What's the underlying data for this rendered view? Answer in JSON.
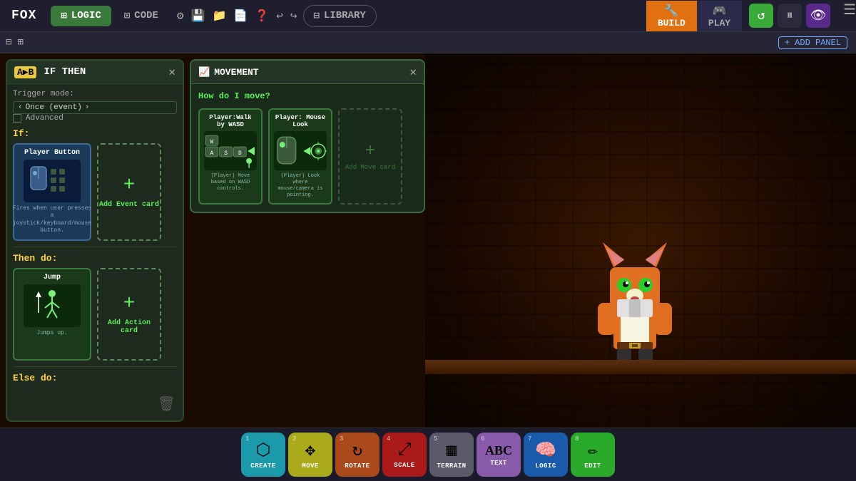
{
  "app": {
    "title": "FOX"
  },
  "topnav": {
    "logo": "FOX",
    "logic_label": "LOGIC",
    "code_label": "CODE",
    "library_label": "LIBRARY",
    "build_label": "BUILD",
    "play_label": "PLAY",
    "icons": [
      "⚙",
      "💾",
      "📁",
      "📄",
      "❓",
      "↩",
      "↪"
    ]
  },
  "secondnav": {
    "add_panel_label": "+ ADD PANEL"
  },
  "if_then_panel": {
    "title": "IF THEN",
    "trigger_mode_label": "Trigger mode:",
    "trigger_value": "Once (event)",
    "advanced_label": "Advanced",
    "if_label": "If:",
    "player_button_card": {
      "title": "Player Button",
      "desc": "Fires when user presses a joystick/keyboard/mouse button."
    },
    "add_event_card": {
      "label": "Add Event card"
    },
    "then_do_label": "Then do:",
    "jump_card": {
      "title": "Jump",
      "desc": "Jumps up."
    },
    "add_action_card": {
      "label": "Add Action card"
    },
    "else_do_label": "Else do:"
  },
  "movement_panel": {
    "title": "MOVEMENT",
    "how_move_label": "How do I move?",
    "card1": {
      "title": "Player:Walk by WASD",
      "desc": "(Player) Move based on WASD controls."
    },
    "card2": {
      "title": "Player: Mouse Look",
      "desc": "(Player) Look where mouse/camera is pointing."
    },
    "add_move_card": {
      "label": "Add Move card"
    }
  },
  "bottom_toolbar": {
    "tools": [
      {
        "num": "1",
        "icon": "⬡",
        "label": "CREATE",
        "style": "create"
      },
      {
        "num": "2",
        "icon": "✥",
        "label": "MOVE",
        "style": "move"
      },
      {
        "num": "3",
        "icon": "↻",
        "label": "ROTATE",
        "style": "rotate"
      },
      {
        "num": "4",
        "icon": "⤢",
        "label": "SCALE",
        "style": "scale"
      },
      {
        "num": "5",
        "icon": "▦",
        "label": "TERRAIN",
        "style": "terrain"
      },
      {
        "num": "6",
        "icon": "Ⓣ",
        "label": "TEXT",
        "style": "text"
      },
      {
        "num": "7",
        "icon": "🧠",
        "label": "LOGIC",
        "style": "logic"
      },
      {
        "num": "8",
        "icon": "✏",
        "label": "EDIT",
        "style": "edit"
      }
    ]
  }
}
